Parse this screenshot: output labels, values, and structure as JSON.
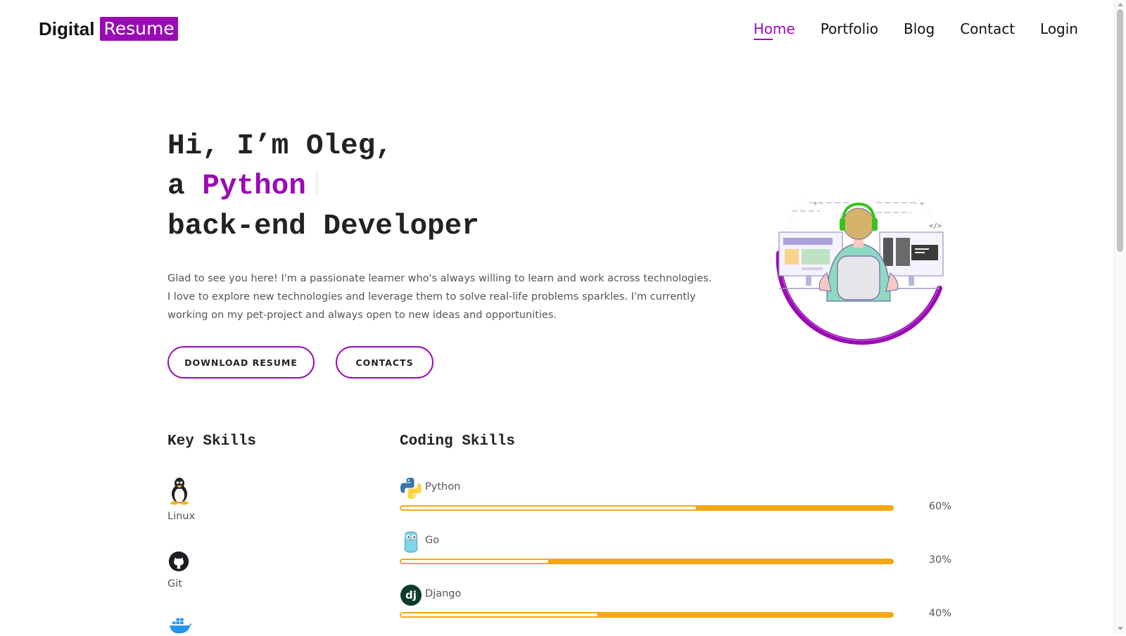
{
  "brand": {
    "text": "Digital",
    "accent": "Resume",
    "accent_color": "#9a0bb5"
  },
  "nav": {
    "items": [
      {
        "label": "Home",
        "active": true
      },
      {
        "label": "Portfolio",
        "active": false
      },
      {
        "label": "Blog",
        "active": false
      },
      {
        "label": "Contact",
        "active": false
      },
      {
        "label": "Login",
        "active": false
      }
    ]
  },
  "hero": {
    "line1": "Hi, I’m Oleg,",
    "line2_prefix": "a",
    "line2_highlight": "Python",
    "line3": "back-end Developer",
    "intro": "Glad to see you here! I'm a passionate learner who's always willing to learn and work across technologies. I love to explore new technologies and leverage them to solve real-life problems sparkles. I'm currently working on my pet-project and always open to new ideas and opportunities.",
    "download_button": "DOWNLOAD RESUME",
    "contacts_button": "CONTACTS",
    "illustration": "developer-at-computer-illustration"
  },
  "key_skills": {
    "title": "Key Skills",
    "items": [
      {
        "label": "Linux",
        "icon": "linux-tux-icon"
      },
      {
        "label": "Git",
        "icon": "github-icon"
      },
      {
        "label": "",
        "icon": "docker-whale-icon"
      }
    ]
  },
  "coding_skills": {
    "title": "Coding Skills",
    "items": [
      {
        "name": "Python",
        "percent_label": "60%",
        "value": 60,
        "icon": "python-icon"
      },
      {
        "name": "Go",
        "percent_label": "30%",
        "value": 30,
        "icon": "go-gopher-icon"
      },
      {
        "name": "Django",
        "percent_label": "40%",
        "value": 40,
        "icon": "django-icon"
      }
    ]
  },
  "colors": {
    "accent": "#9a0bb5",
    "progress": "#f5a811"
  }
}
